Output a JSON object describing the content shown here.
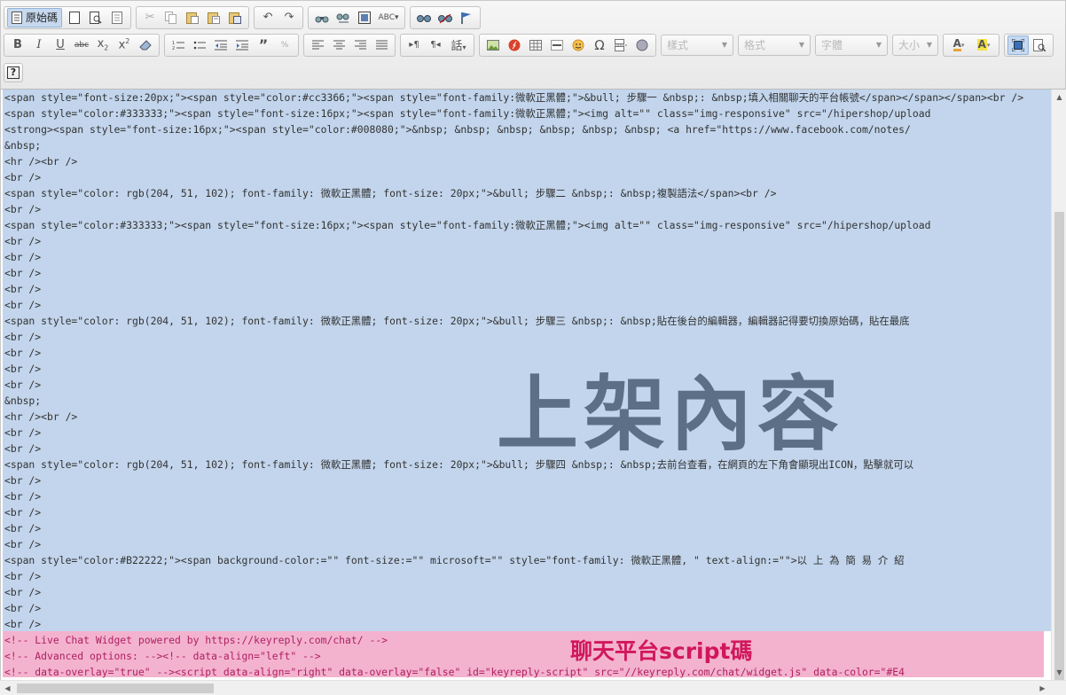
{
  "toolbar": {
    "source_label": "原始碼",
    "styles_combo": "樣式",
    "format_combo": "格式",
    "font_combo": "字體",
    "size_combo": "大小",
    "help_label": "?",
    "paste_text_glyph": "話"
  },
  "code_lines": [
    "<span style=\"font-size:20px;\"><span style=\"color:#cc3366;\"><span style=\"font-family:微軟正黑體;\">&bull; 步驟一 &nbsp;: &nbsp;填入相關聊天的平台帳號</span></span></span><br />",
    "<span style=\"color:#333333;\"><span style=\"font-size:16px;\"><span style=\"font-family:微軟正黑體;\"><img alt=\"\" class=\"img-responsive\" src=\"/hipershop/upload",
    "<strong><span style=\"font-size:16px;\"><span style=\"color:#008080;\">&nbsp; &nbsp; &nbsp; &nbsp; &nbsp; &nbsp; <a href=\"https://www.facebook.com/notes/",
    "&nbsp;",
    "<hr /><br />",
    "<br />",
    "<span style=\"color: rgb(204, 51, 102); font-family: 微軟正黑體; font-size: 20px;\">&bull; 步驟二 &nbsp;: &nbsp;複製語法</span><br />",
    "<br />",
    "<span style=\"color:#333333;\"><span style=\"font-size:16px;\"><span style=\"font-family:微軟正黑體;\"><img alt=\"\" class=\"img-responsive\" src=\"/hipershop/upload",
    "<br />",
    "<br />",
    "<br />",
    "<br />",
    "<br />",
    "<span style=\"color: rgb(204, 51, 102); font-family: 微軟正黑體; font-size: 20px;\">&bull; 步驟三 &nbsp;: &nbsp;貼在後台的編輯器，編輯器記得要切換原始碼，貼在最底",
    "<br />",
    "<br />",
    "<br />",
    "<br />",
    "&nbsp;",
    "<hr /><br />",
    "<br />",
    "<br />",
    "<span style=\"color: rgb(204, 51, 102); font-family: 微軟正黑體; font-size: 20px;\">&bull; 步驟四 &nbsp;: &nbsp;去前台查看，在網頁的左下角會顯現出ICON，點擊就可以",
    "<br />",
    "<br />",
    "<br />",
    "<br />",
    "<br />",
    "<span style=\"color:#B22222;\"><span background-color:=\"\" font-size:=\"\" microsoft=\"\" style=\"font-family: 微軟正黑體, \" text-align:=\"\">以 上 為 簡 易 介 紹",
    "<br />",
    "<br />",
    "<br />",
    "<br />",
    "<!-- Live Chat Widget powered by https://keyreply.com/chat/ -->",
    "<!-- Advanced options: --><!-- data-align=\"left\" -->",
    "<!-- data-overlay=\"true\" --><script data-align=\"right\" data-overlay=\"false\" id=\"keyreply-script\" src=\"//keyreply.com/chat/widget.js\" data-color=\"#E4"
  ],
  "annotations": {
    "content_label": "上架內容",
    "script_label": "聊天平台script碼"
  },
  "colors": {
    "selection": "#c2d5ec",
    "script_highlight": "#f3b3cf",
    "content_label": "#5c6f86",
    "script_label": "#d1175a",
    "comment_text": "#b02060"
  }
}
